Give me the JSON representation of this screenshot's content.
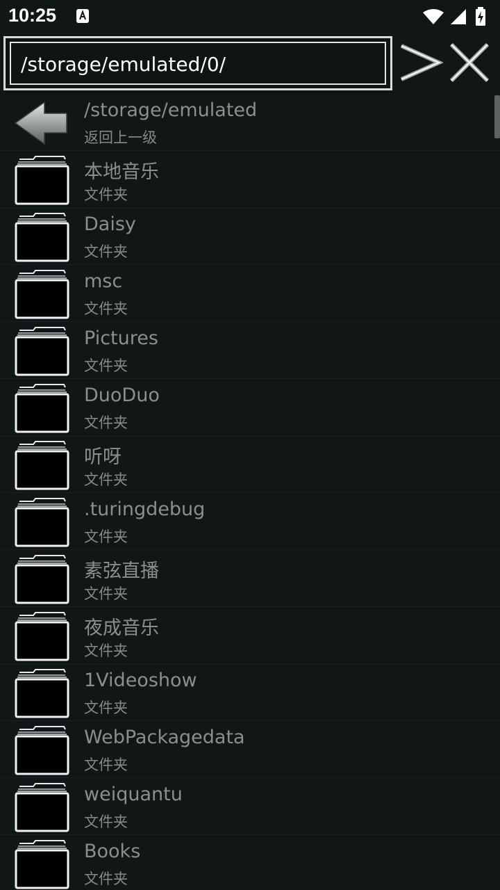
{
  "status_bar": {
    "time": "10:25"
  },
  "path_bar": {
    "value": "/storage/emulated/0/"
  },
  "parent_row": {
    "title": "/storage/emulated",
    "subtitle": "返回上一级"
  },
  "folders": [
    {
      "name": "本地音乐",
      "type": "文件夹"
    },
    {
      "name": "Daisy",
      "type": "文件夹"
    },
    {
      "name": "msc",
      "type": "文件夹"
    },
    {
      "name": "Pictures",
      "type": "文件夹"
    },
    {
      "name": "DuoDuo",
      "type": "文件夹"
    },
    {
      "name": "听呀",
      "type": "文件夹"
    },
    {
      "name": ".turingdebug",
      "type": "文件夹"
    },
    {
      "name": "素弦直播",
      "type": "文件夹"
    },
    {
      "name": "夜成音乐",
      "type": "文件夹"
    },
    {
      "name": "1Videoshow",
      "type": "文件夹"
    },
    {
      "name": "WebPackagedata",
      "type": "文件夹"
    },
    {
      "name": "weiquantu",
      "type": "文件夹"
    },
    {
      "name": "Books",
      "type": "文件夹"
    }
  ],
  "icons": {
    "parent": "back-arrow-icon",
    "folder": "folder-icon",
    "go": "go-arrow-icon",
    "close": "close-icon",
    "wifi": "wifi-icon",
    "signal": "signal-icon",
    "battery": "battery-charging-icon"
  },
  "colors": {
    "background": "#111617",
    "text_primary": "#8a8f90",
    "path_text": "#ffffff"
  }
}
